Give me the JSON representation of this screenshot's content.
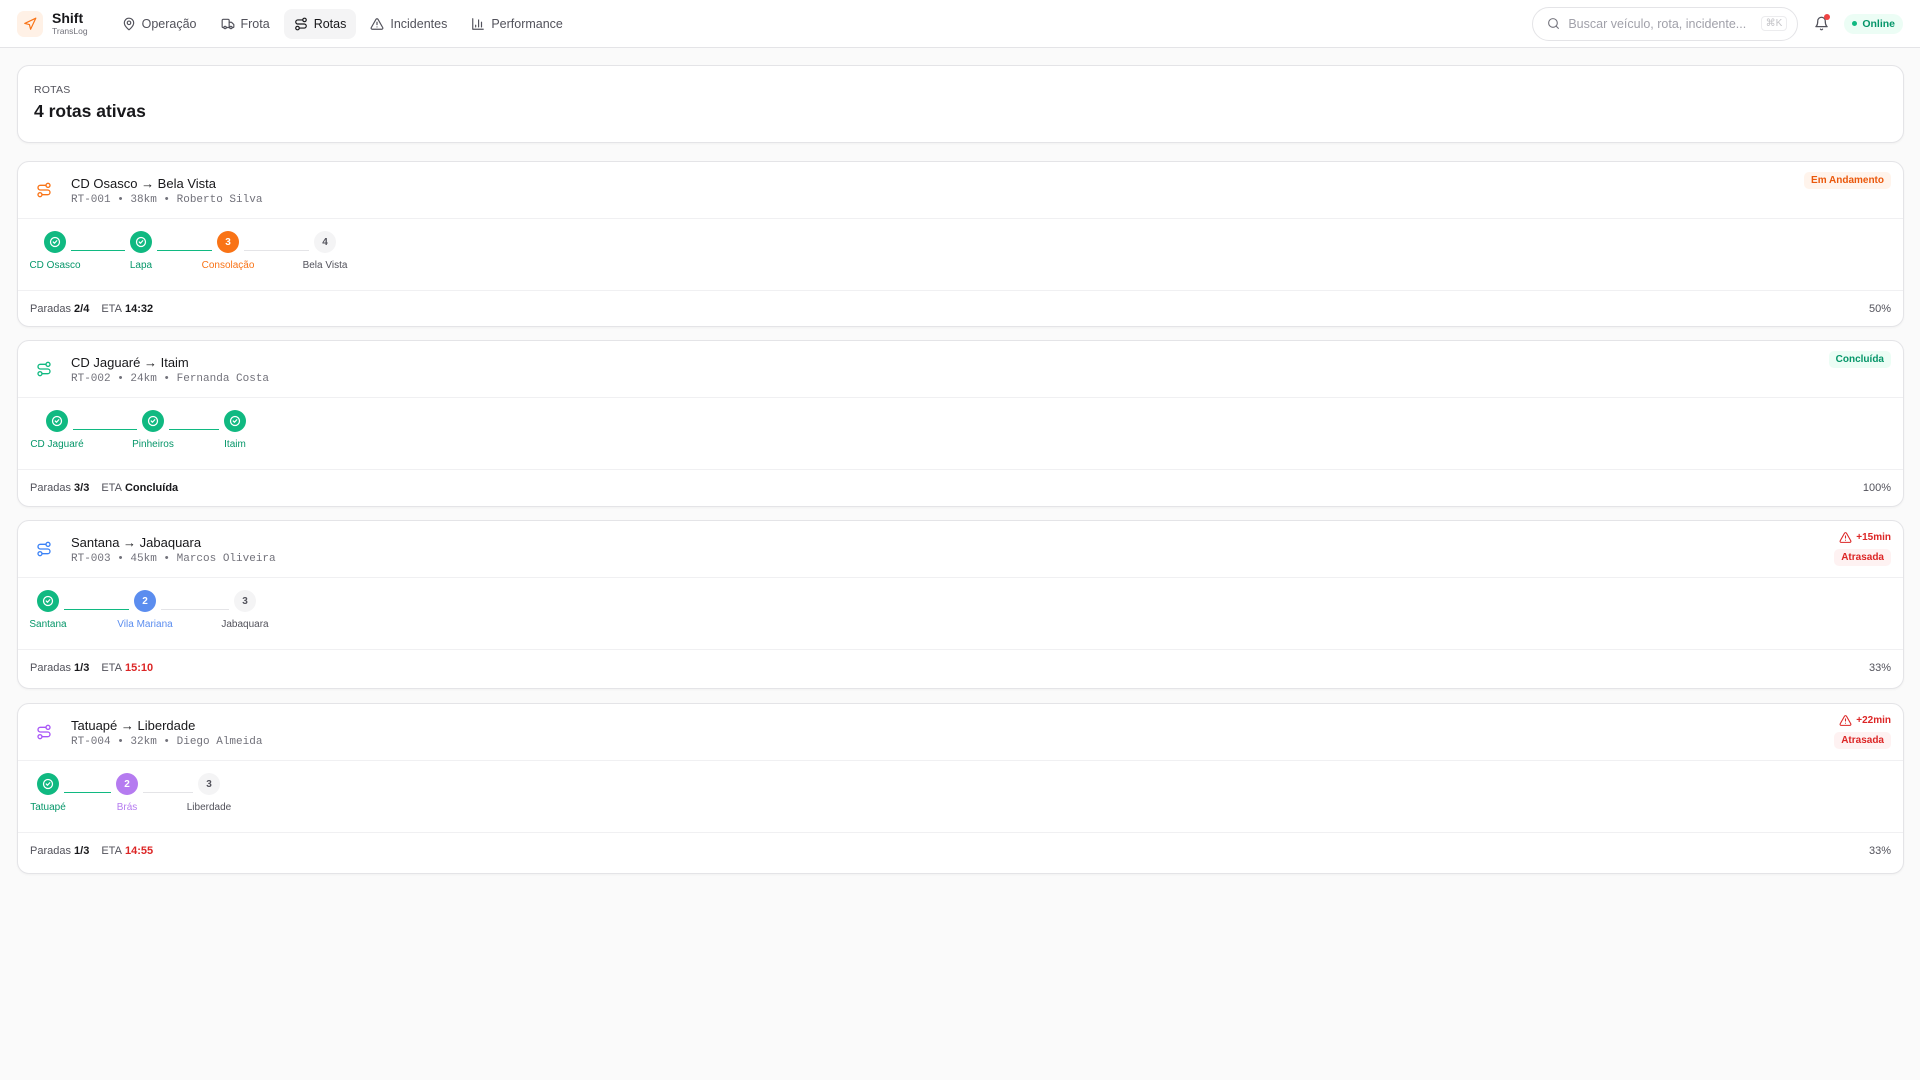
{
  "brand": {
    "name": "Shift",
    "subtitle": "TransLog",
    "accent": "#f97316"
  },
  "nav": [
    {
      "label": "Operação",
      "icon": "map-pin-icon",
      "active": false
    },
    {
      "label": "Frota",
      "icon": "truck-icon",
      "active": false
    },
    {
      "label": "Rotas",
      "icon": "route-icon",
      "active": true
    },
    {
      "label": "Incidentes",
      "icon": "alert-triangle-icon",
      "active": false
    },
    {
      "label": "Performance",
      "icon": "bar-chart-icon",
      "active": false
    }
  ],
  "search": {
    "placeholder": "Buscar veículo, rota, incidente...",
    "shortcut": "⌘K"
  },
  "status": {
    "label": "Online",
    "color": "#10b981"
  },
  "page": {
    "eyebrow": "ROTAS",
    "title": "4 rotas ativas"
  },
  "footer_labels": {
    "stops": "Paradas",
    "eta": "ETA"
  },
  "routes": [
    {
      "id": "RT-001",
      "title": "CD Osasco → Bela Vista",
      "meta": "RT-001 • 38km • Roberto Silva",
      "icon_color": "#f97316",
      "status": {
        "label": "Em Andamento",
        "color": "#ea580c",
        "bg": "#fff4ec"
      },
      "delay": null,
      "stops": [
        {
          "label": "CD Osasco",
          "state": "done"
        },
        {
          "label": "Lapa",
          "state": "done"
        },
        {
          "label": "Consolação",
          "state": "current",
          "number": "3",
          "color": "#f97316"
        },
        {
          "label": "Bela Vista",
          "state": "pending",
          "number": "4"
        }
      ],
      "progress_stops": "2/4",
      "eta": "14:32",
      "eta_color": "#18181b",
      "percent": "50%"
    },
    {
      "id": "RT-002",
      "title": "CD Jaguaré → Itaim",
      "meta": "RT-002 • 24km • Fernanda Costa",
      "icon_color": "#10b981",
      "status": {
        "label": "Concluída",
        "color": "#059669",
        "bg": "#ecfdf5"
      },
      "delay": null,
      "stops": [
        {
          "label": "CD Jaguaré",
          "state": "done"
        },
        {
          "label": "Pinheiros",
          "state": "done"
        },
        {
          "label": "Itaim",
          "state": "done"
        }
      ],
      "progress_stops": "3/3",
      "eta": "Concluída",
      "eta_color": "#18181b",
      "percent": "100%"
    },
    {
      "id": "RT-003",
      "title": "Santana → Jabaquara",
      "meta": "RT-003 • 45km • Marcos Oliveira",
      "icon_color": "#3b82f6",
      "status": {
        "label": "Atrasada",
        "color": "#dc2626",
        "bg": "#fef2f2"
      },
      "delay": "+15min",
      "stops": [
        {
          "label": "Santana",
          "state": "done"
        },
        {
          "label": "Vila Mariana",
          "state": "current",
          "number": "2",
          "color": "#5b8def"
        },
        {
          "label": "Jabaquara",
          "state": "pending",
          "number": "3"
        }
      ],
      "progress_stops": "1/3",
      "eta": "15:10",
      "eta_color": "#dc2626",
      "percent": "33%"
    },
    {
      "id": "RT-004",
      "title": "Tatuapé → Liberdade",
      "meta": "RT-004 • 32km • Diego Almeida",
      "icon_color": "#a855f7",
      "status": {
        "label": "Atrasada",
        "color": "#dc2626",
        "bg": "#fef2f2"
      },
      "delay": "+22min",
      "stops": [
        {
          "label": "Tatuapé",
          "state": "done"
        },
        {
          "label": "Brás",
          "state": "current",
          "number": "2",
          "color": "#b57bf0"
        },
        {
          "label": "Liberdade",
          "state": "pending",
          "number": "3"
        }
      ],
      "progress_stops": "1/3",
      "eta": "14:55",
      "eta_color": "#dc2626",
      "percent": "33%"
    }
  ]
}
